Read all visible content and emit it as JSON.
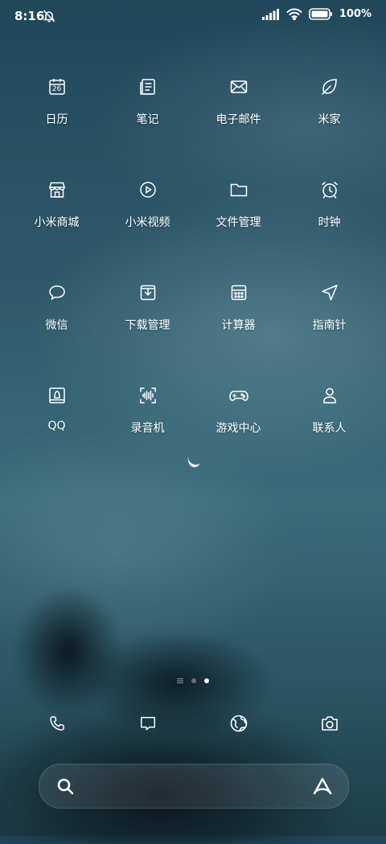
{
  "status_bar": {
    "time": "8:16",
    "battery_text": "100%"
  },
  "apps": [
    {
      "label": "日历",
      "icon": "calendar-icon",
      "calendar_day": "26"
    },
    {
      "label": "笔记",
      "icon": "notes-icon"
    },
    {
      "label": "电子邮件",
      "icon": "mail-icon"
    },
    {
      "label": "米家",
      "icon": "leaf-icon"
    },
    {
      "label": "小米商城",
      "icon": "store-icon"
    },
    {
      "label": "小米视频",
      "icon": "video-icon"
    },
    {
      "label": "文件管理",
      "icon": "folder-icon"
    },
    {
      "label": "时钟",
      "icon": "alarm-clock-icon"
    },
    {
      "label": "微信",
      "icon": "chat-bubble-icon"
    },
    {
      "label": "下载管理",
      "icon": "download-icon"
    },
    {
      "label": "计算器",
      "icon": "calculator-icon"
    },
    {
      "label": "指南针",
      "icon": "compass-arrow-icon"
    },
    {
      "label": "QQ",
      "icon": "qq-icon"
    },
    {
      "label": "录音机",
      "icon": "recorder-icon"
    },
    {
      "label": "游戏中心",
      "icon": "gamepad-icon"
    },
    {
      "label": "联系人",
      "icon": "contact-icon"
    }
  ],
  "page_indicator": {
    "pages": 3,
    "active_index": 2
  },
  "dock": [
    {
      "icon": "phone-icon"
    },
    {
      "icon": "message-icon"
    },
    {
      "icon": "browser-icon"
    },
    {
      "icon": "camera-icon"
    }
  ],
  "search_bar": {
    "icon": "search-icon",
    "assistant_icon": "assistant-icon"
  }
}
